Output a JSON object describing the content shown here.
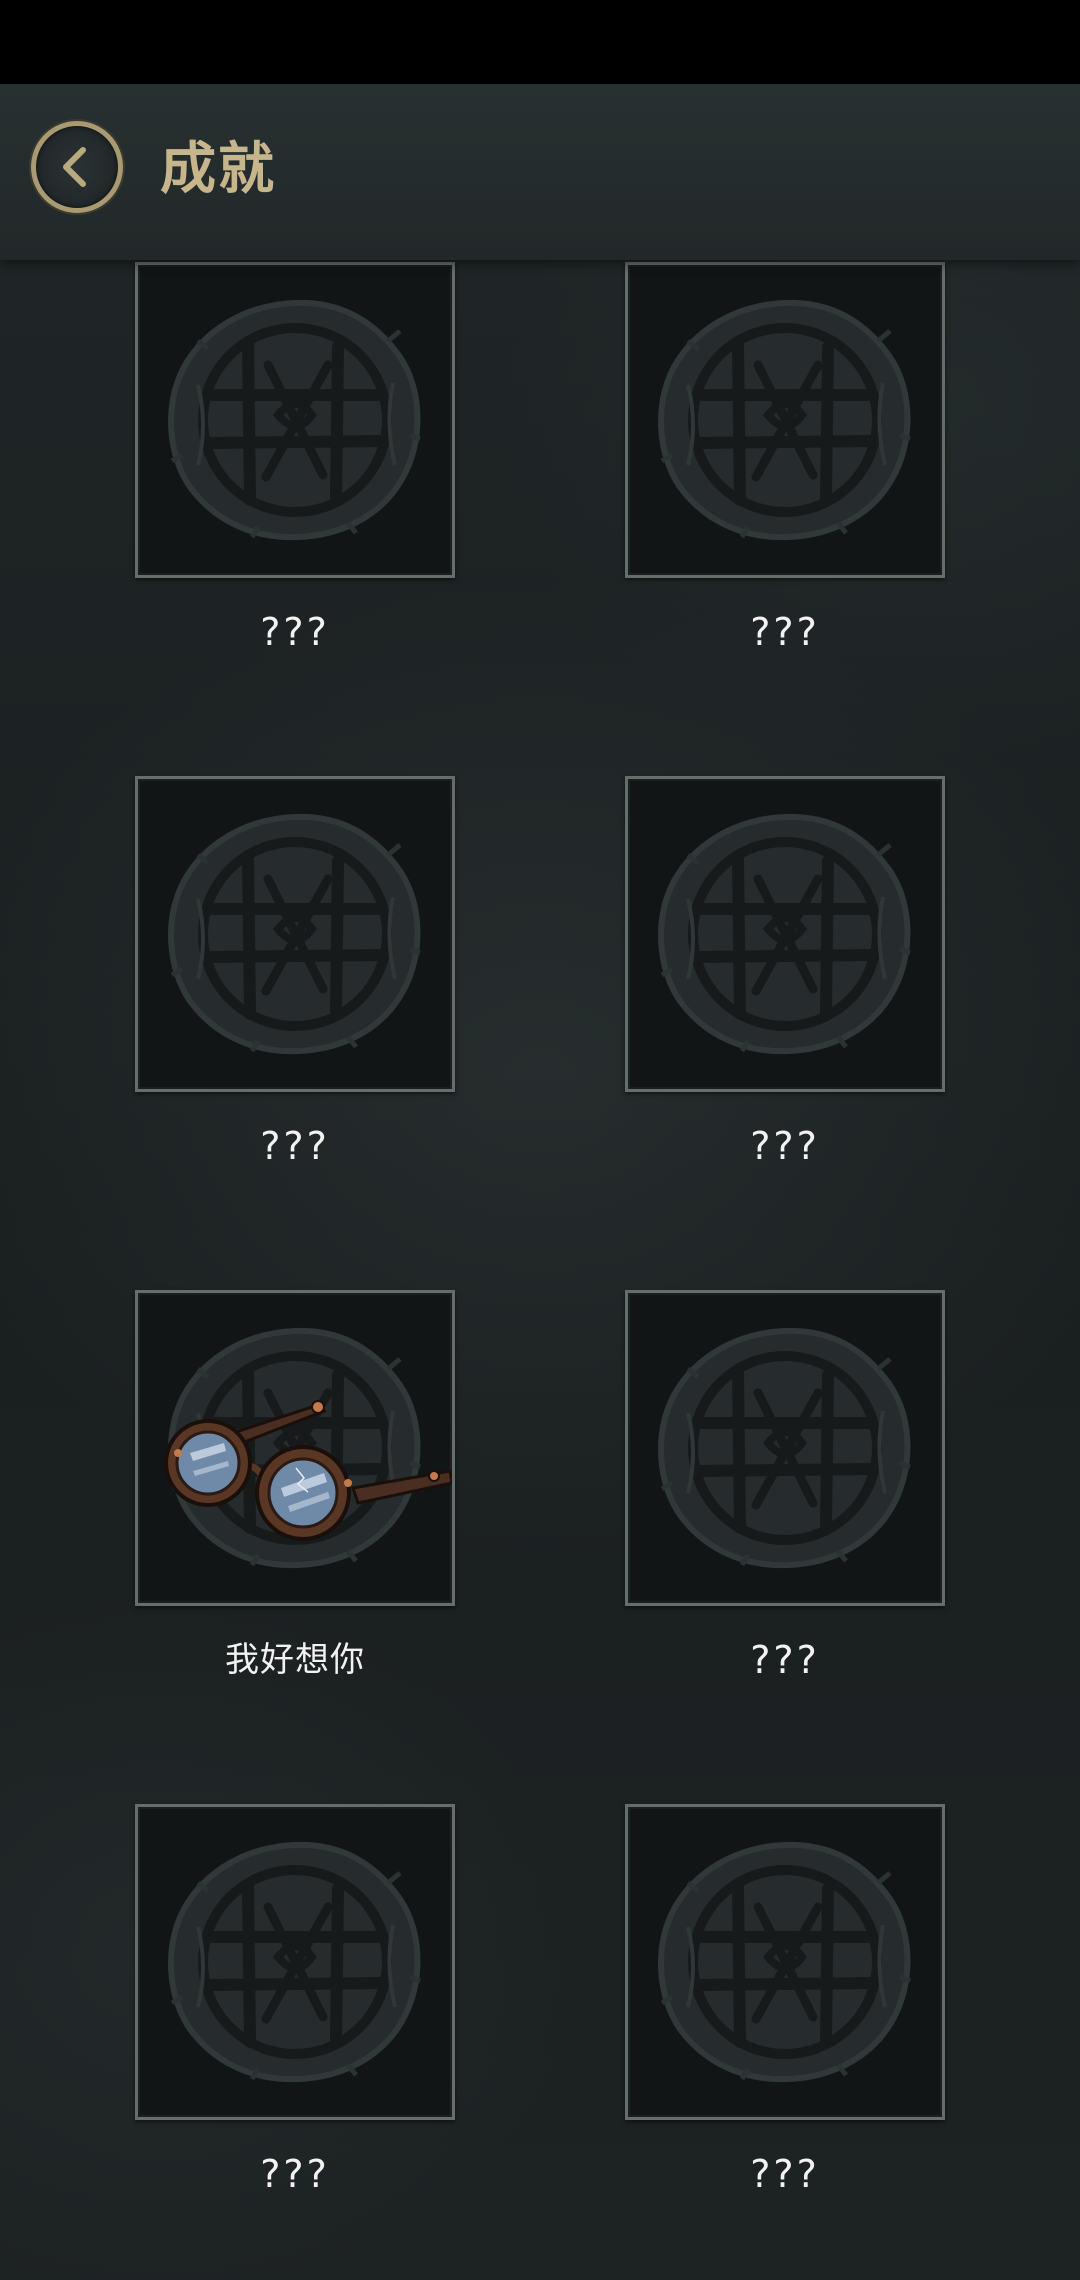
{
  "header": {
    "back_icon": "chevron-left-icon",
    "title": "成就"
  },
  "achievements": [
    {
      "label": "???",
      "unlocked": false,
      "icon": "locked-seal-icon"
    },
    {
      "label": "???",
      "unlocked": false,
      "icon": "locked-seal-icon"
    },
    {
      "label": "???",
      "unlocked": false,
      "icon": "locked-seal-icon"
    },
    {
      "label": "???",
      "unlocked": false,
      "icon": "locked-seal-icon"
    },
    {
      "label": "我好想你",
      "unlocked": true,
      "icon": "round-glasses-icon"
    },
    {
      "label": "???",
      "unlocked": false,
      "icon": "locked-seal-icon"
    },
    {
      "label": "???",
      "unlocked": false,
      "icon": "locked-seal-icon"
    },
    {
      "label": "???",
      "unlocked": false,
      "icon": "locked-seal-icon"
    }
  ],
  "colors": {
    "accent_gold": "#c7b68c",
    "background": "#1c2122",
    "frame_border": "#666e6c"
  }
}
